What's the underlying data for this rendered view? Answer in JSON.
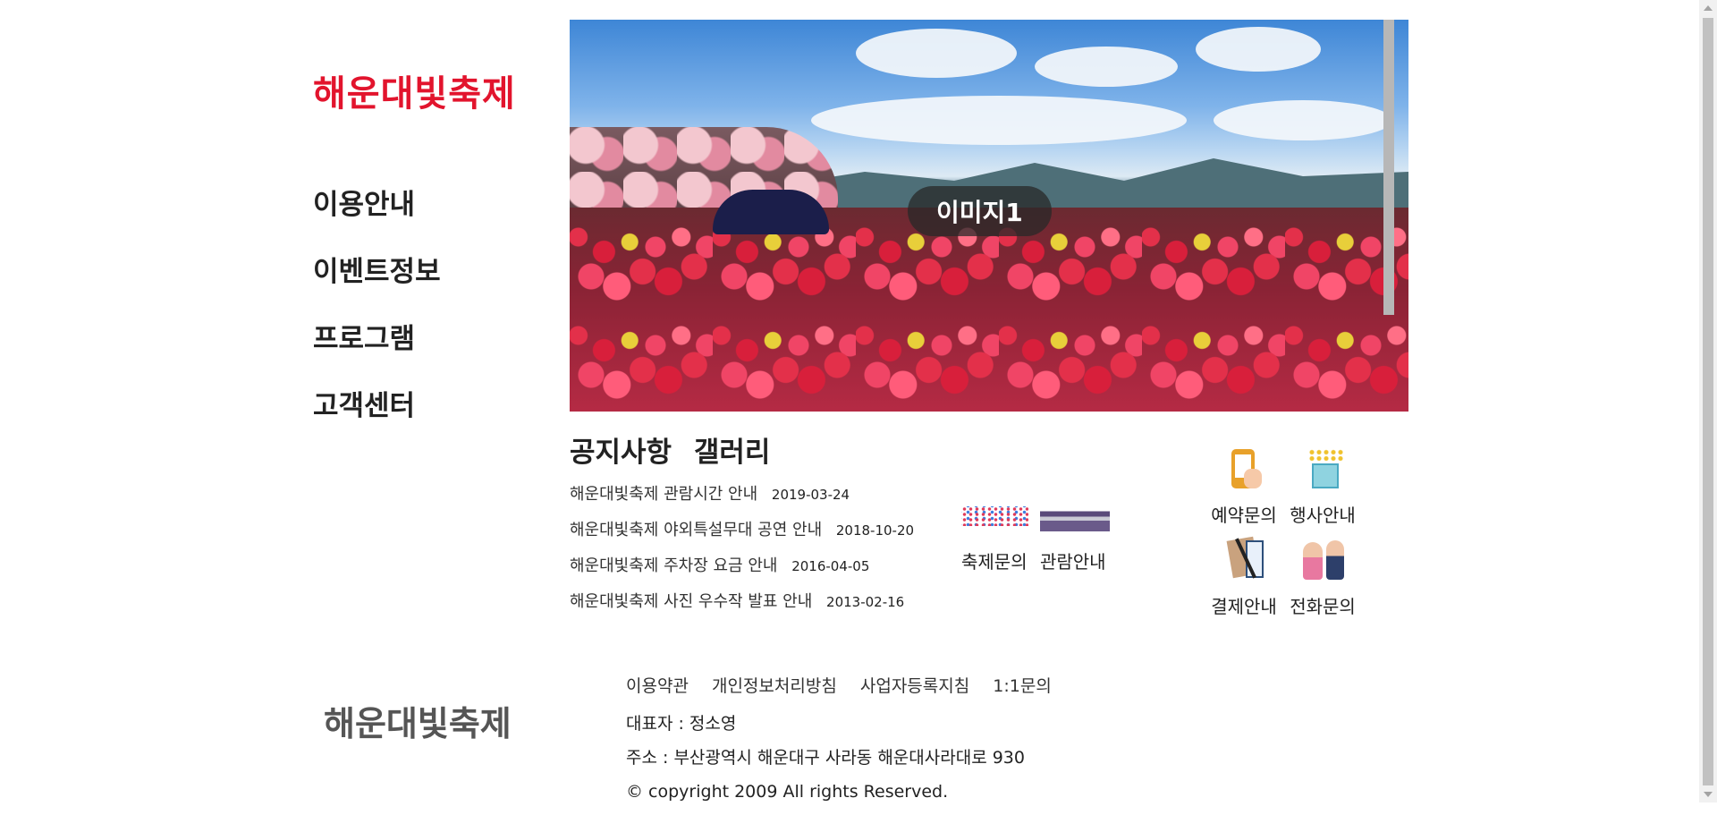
{
  "header": {
    "logo": "해운대빛축제"
  },
  "nav": {
    "items": [
      "이용안내",
      "이벤트정보",
      "프로그램",
      "고객센터"
    ]
  },
  "slider": {
    "label": "이미지1"
  },
  "notice": {
    "tabs": [
      "공지사항",
      "갤러리"
    ],
    "items": [
      {
        "title": "해운대빛축제 관람시간 안내",
        "date": "2019-03-24"
      },
      {
        "title": "해운대빛축제 야외특설무대 공연 안내",
        "date": "2018-10-20"
      },
      {
        "title": "해운대빛축제 주차장 요금 안내",
        "date": "2016-04-05"
      },
      {
        "title": "해운대빛축제 사진 우수작 발표 안내",
        "date": "2013-02-16"
      }
    ]
  },
  "middle": {
    "labels": [
      "축제문의",
      "관람안내"
    ]
  },
  "quick": {
    "items": [
      {
        "label": "예약문의",
        "icon": "phone-reservation-icon"
      },
      {
        "label": "행사안내",
        "icon": "gift-event-icon"
      },
      {
        "label": "결제안내",
        "icon": "payment-document-icon"
      },
      {
        "label": "전화문의",
        "icon": "call-people-icon"
      }
    ]
  },
  "footer": {
    "logo": "해운대빛축제",
    "links": [
      "이용약관",
      "개인정보처리방침",
      "사업자등록지침",
      "1:1문의"
    ],
    "representative": "대표자 : 정소영",
    "address": "주소 : 부산광역시 해운대구 사라동 해운대사라대로 930",
    "copyright": "© copyright 2009 All rights Reserved."
  },
  "colors": {
    "brand": "#e2142d",
    "footer_logo": "#555555"
  }
}
